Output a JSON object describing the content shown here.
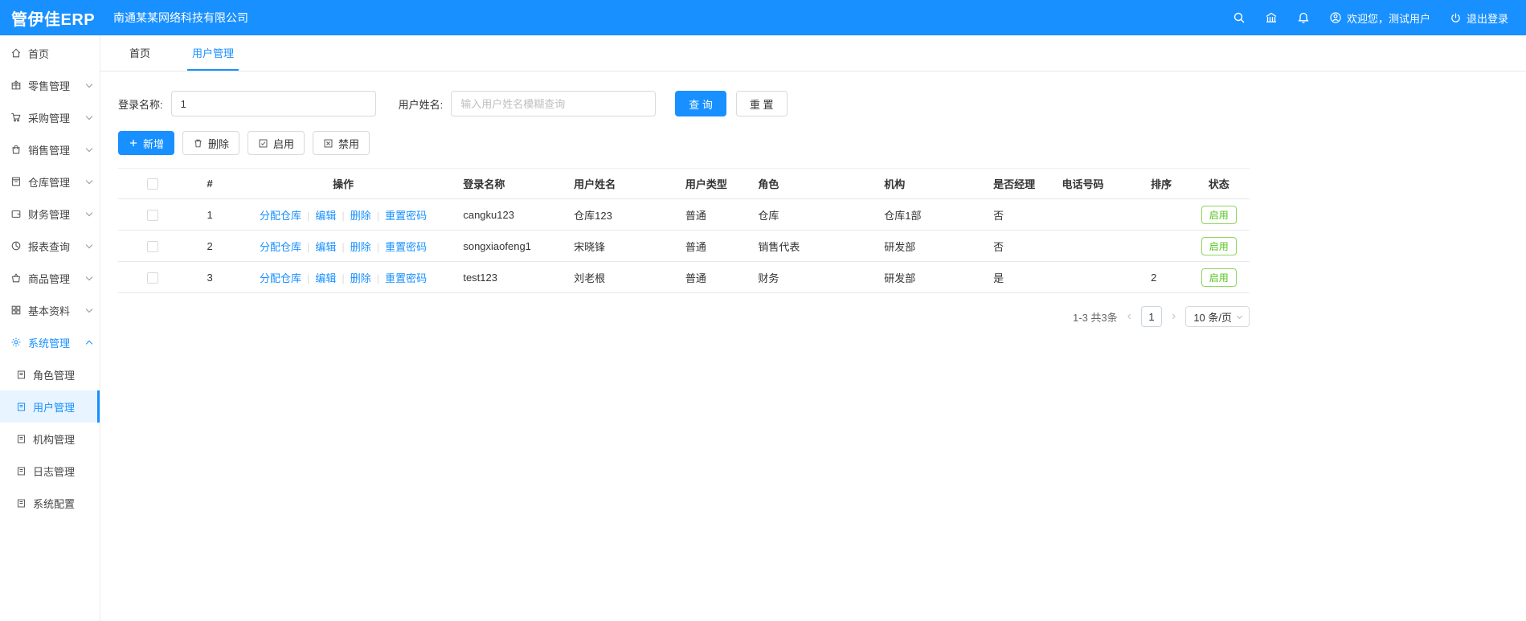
{
  "colors": {
    "accent": "#1890ff",
    "success": "#52c41a"
  },
  "header": {
    "logo": "管伊佳ERP",
    "company": "南通某某网络科技有限公司",
    "welcome": "欢迎您，测试用户",
    "logout": "退出登录"
  },
  "sidebar": {
    "items": [
      {
        "label": "首页"
      },
      {
        "label": "零售管理"
      },
      {
        "label": "采购管理"
      },
      {
        "label": "销售管理"
      },
      {
        "label": "仓库管理"
      },
      {
        "label": "财务管理"
      },
      {
        "label": "报表查询"
      },
      {
        "label": "商品管理"
      },
      {
        "label": "基本资料"
      },
      {
        "label": "系统管理"
      }
    ],
    "submenu": [
      {
        "label": "角色管理"
      },
      {
        "label": "用户管理"
      },
      {
        "label": "机构管理"
      },
      {
        "label": "日志管理"
      },
      {
        "label": "系统配置"
      }
    ]
  },
  "tabs": [
    {
      "label": "首页"
    },
    {
      "label": "用户管理"
    }
  ],
  "filter": {
    "login_label": "登录名称:",
    "login_value": "1",
    "name_label": "用户姓名:",
    "name_placeholder": "输入用户姓名模糊查询",
    "search_btn": "查 询",
    "reset_btn": "重 置"
  },
  "toolbar": {
    "add": "新增",
    "delete": "删除",
    "enable": "启用",
    "disable": "禁用"
  },
  "table": {
    "headers": [
      "#",
      "操作",
      "登录名称",
      "用户姓名",
      "用户类型",
      "角色",
      "机构",
      "是否经理",
      "电话号码",
      "排序",
      "状态"
    ],
    "actions": {
      "assign": "分配仓库",
      "edit": "编辑",
      "del": "删除",
      "reset_pwd": "重置密码"
    },
    "rows": [
      {
        "index": "1",
        "login_name": "cangku123",
        "user_name": "仓库123",
        "user_type": "普通",
        "role": "仓库",
        "org": "仓库1部",
        "is_manager": "否",
        "phone": "",
        "sort": "",
        "status": "启用"
      },
      {
        "index": "2",
        "login_name": "songxiaofeng1",
        "user_name": "宋晓锋",
        "user_type": "普通",
        "role": "销售代表",
        "org": "研发部",
        "is_manager": "否",
        "phone": "",
        "sort": "",
        "status": "启用"
      },
      {
        "index": "3",
        "login_name": "test123",
        "user_name": "刘老根",
        "user_type": "普通",
        "role": "财务",
        "org": "研发部",
        "is_manager": "是",
        "phone": "",
        "sort": "2",
        "status": "启用"
      }
    ]
  },
  "pagination": {
    "total": "1-3 共3条",
    "current_page": "1",
    "page_size": "10 条/页"
  }
}
